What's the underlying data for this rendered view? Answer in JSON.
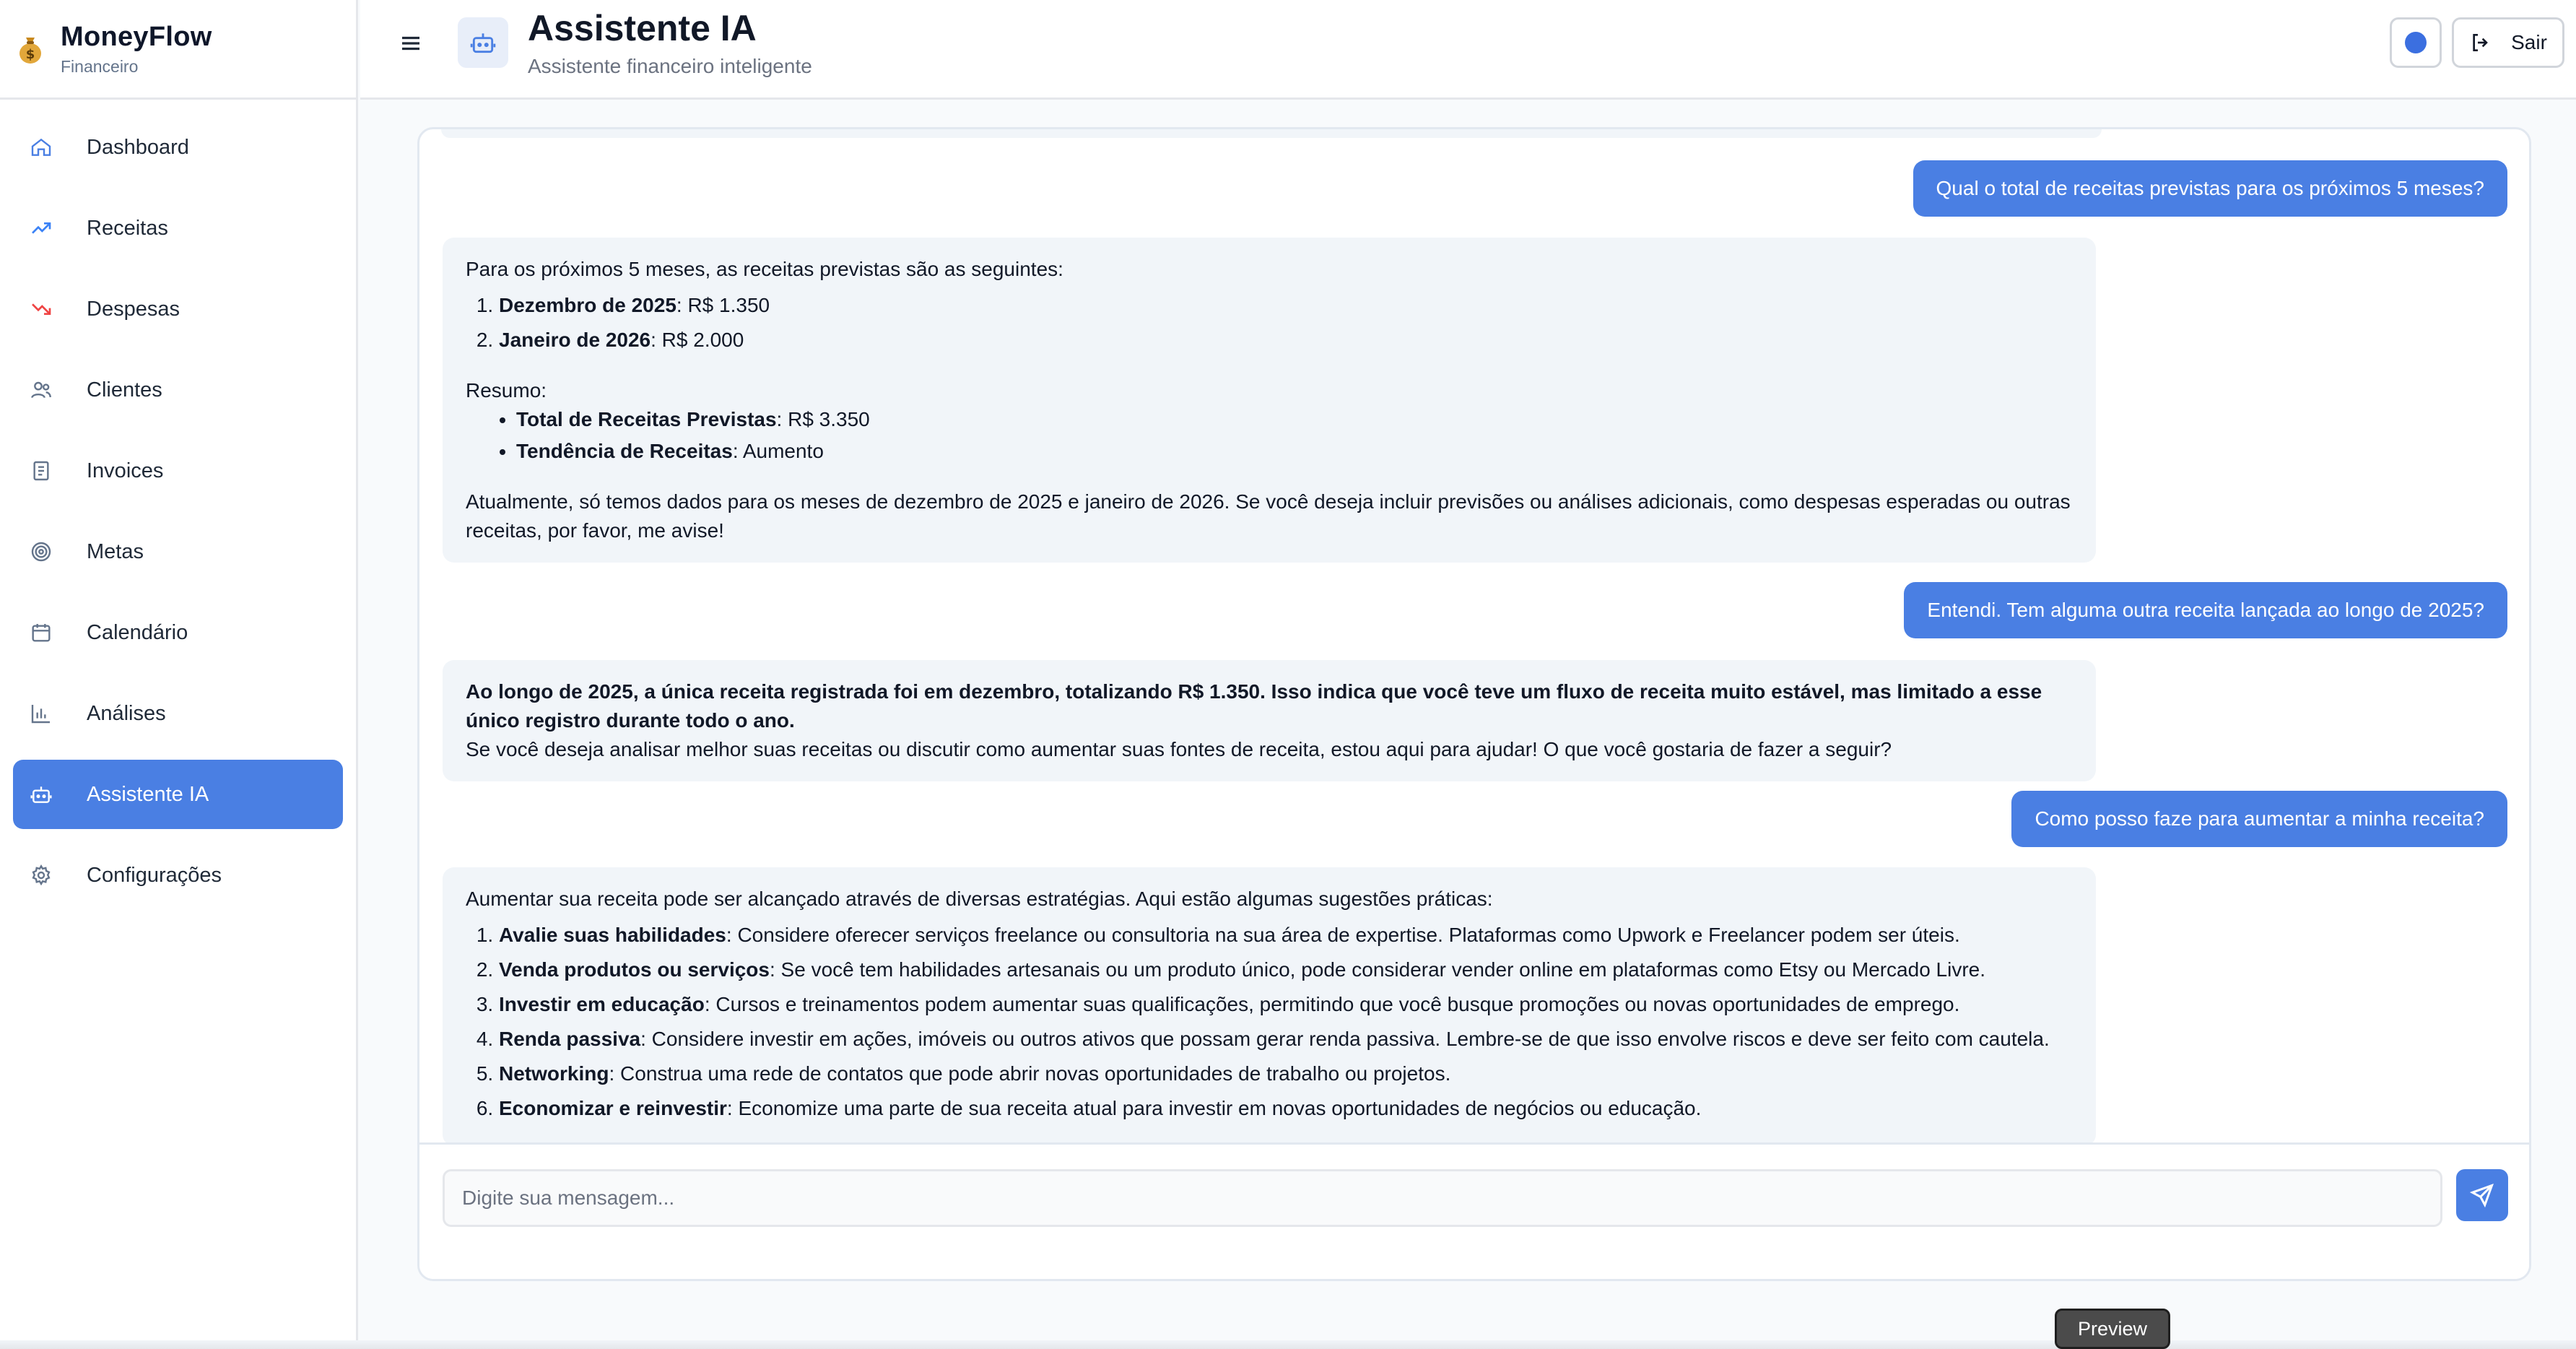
{
  "brand": {
    "name": "MoneyFlow",
    "subtitle": "Financeiro"
  },
  "sidebar": {
    "items": [
      {
        "label": "Dashboard",
        "icon": "home-icon",
        "color": "#4a7fe3"
      },
      {
        "label": "Receitas",
        "icon": "trending-up-icon",
        "color": "#3b82f6"
      },
      {
        "label": "Despesas",
        "icon": "trending-down-icon",
        "color": "#ef4444"
      },
      {
        "label": "Clientes",
        "icon": "users-icon",
        "color": "#64748b"
      },
      {
        "label": "Invoices",
        "icon": "receipt-icon",
        "color": "#64748b"
      },
      {
        "label": "Metas",
        "icon": "target-icon",
        "color": "#64748b"
      },
      {
        "label": "Calendário",
        "icon": "calendar-icon",
        "color": "#64748b"
      },
      {
        "label": "Análises",
        "icon": "bar-chart-icon",
        "color": "#64748b"
      },
      {
        "label": "Assistente IA",
        "icon": "bot-icon",
        "color": "#ffffff",
        "active": true
      },
      {
        "label": "Configurações",
        "icon": "gear-icon",
        "color": "#64748b"
      }
    ]
  },
  "header": {
    "title": "Assistente IA",
    "subtitle": "Assistente financeiro inteligente",
    "logout_label": "Sair"
  },
  "chat": {
    "messages": [
      {
        "role": "user",
        "text": "Qual o total de receitas previstas para os próximos 5 meses?"
      },
      {
        "role": "assistant",
        "intro": "Para os próximos 5 meses, as receitas previstas são as seguintes:",
        "list": [
          {
            "bold": "Dezembro de 2025",
            "rest": ": R$ 1.350"
          },
          {
            "bold": "Janeiro de 2026",
            "rest": ": R$ 2.000"
          }
        ],
        "summary_label": "Resumo:",
        "bullets": [
          {
            "bold": "Total de Receitas Previstas",
            "rest": ": R$ 3.350"
          },
          {
            "bold": "Tendência de Receitas",
            "rest": ": Aumento"
          }
        ],
        "outro": "Atualmente, só temos dados para os meses de dezembro de 2025 e janeiro de 2026. Se você deseja incluir previsões ou análises adicionais, como despesas esperadas ou outras receitas, por favor, me avise!"
      },
      {
        "role": "user",
        "text": "Entendi. Tem alguma outra receita lançada ao longo de 2025?"
      },
      {
        "role": "assistant",
        "bold_text": "Ao longo de 2025, a única receita registrada foi em dezembro, totalizando R$ 1.350. Isso indica que você teve um fluxo de receita muito estável, mas limitado a esse único registro durante todo o ano.",
        "text": "Se você deseja analisar melhor suas receitas ou discutir como aumentar suas fontes de receita, estou aqui para ajudar! O que você gostaria de fazer a seguir?"
      },
      {
        "role": "user",
        "text": "Como posso faze para aumentar a minha receita?"
      },
      {
        "role": "assistant",
        "intro": "Aumentar sua receita pode ser alcançado através de diversas estratégias. Aqui estão algumas sugestões práticas:",
        "list": [
          {
            "bold": "Avalie suas habilidades",
            "rest": ": Considere oferecer serviços freelance ou consultoria na sua área de expertise. Plataformas como Upwork e Freelancer podem ser úteis."
          },
          {
            "bold": "Venda produtos ou serviços",
            "rest": ": Se você tem habilidades artesanais ou um produto único, pode considerar vender online em plataformas como Etsy ou Mercado Livre."
          },
          {
            "bold": "Investir em educação",
            "rest": ": Cursos e treinamentos podem aumentar suas qualificações, permitindo que você busque promoções ou novas oportunidades de emprego."
          },
          {
            "bold": "Renda passiva",
            "rest": ": Considere investir em ações, imóveis ou outros ativos que possam gerar renda passiva. Lembre-se de que isso envolve riscos e deve ser feito com cautela."
          },
          {
            "bold": "Networking",
            "rest": ": Construa uma rede de contatos que pode abrir novas oportunidades de trabalho ou projetos."
          },
          {
            "bold": "Economizar e reinvestir",
            "rest": ": Economize uma parte de sua receita atual para investir em novas oportunidades de negócios ou educação."
          }
        ]
      }
    ],
    "input_placeholder": "Digite sua mensagem..."
  },
  "preview_label": "Preview",
  "colors": {
    "accent": "#4a7fe3",
    "bubble_ai": "#f1f5f9"
  }
}
